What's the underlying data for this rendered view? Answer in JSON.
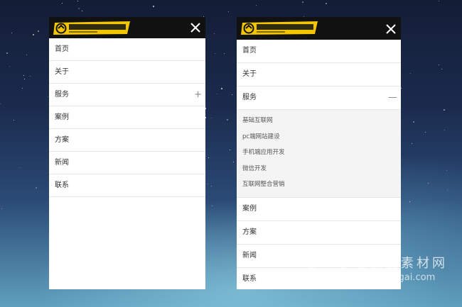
{
  "colors": {
    "topbar": "#111111",
    "logo_yellow": "#f2c500",
    "accent_bg": "#f4f4f4"
  },
  "icons": {
    "close": "close-icon",
    "expand": "plus-icon",
    "collapse": "minus-icon"
  },
  "left_panel": {
    "menu": [
      {
        "label": "首页"
      },
      {
        "label": "关于"
      },
      {
        "label": "服务",
        "toggle": "+"
      },
      {
        "label": "案例"
      },
      {
        "label": "方案"
      },
      {
        "label": "新闻"
      },
      {
        "label": "联系"
      }
    ]
  },
  "right_panel": {
    "menu": [
      {
        "label": "首页"
      },
      {
        "label": "关于"
      },
      {
        "label": "服务",
        "toggle": "—"
      },
      {
        "label": "案例"
      },
      {
        "label": "方案"
      },
      {
        "label": "新闻"
      },
      {
        "label": "联系"
      }
    ],
    "submenu": [
      {
        "label": "基础互联网"
      },
      {
        "label": "pc端网站建设"
      },
      {
        "label": "手机端应用开发"
      },
      {
        "label": "微信开发"
      },
      {
        "label": "互联网整合营销"
      }
    ]
  },
  "watermark": {
    "title": "站长爱素材网",
    "url": "zhanzhangai.com"
  }
}
